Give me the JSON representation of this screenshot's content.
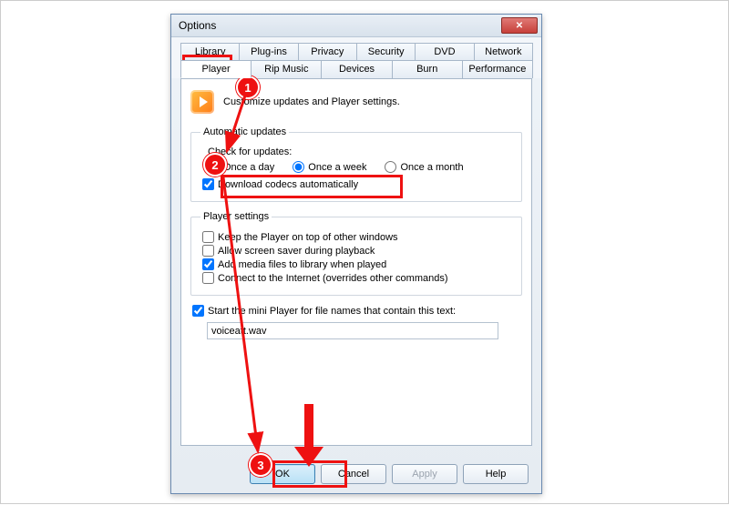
{
  "window": {
    "title": "Options"
  },
  "tabs_row1": [
    "Library",
    "Plug-ins",
    "Privacy",
    "Security",
    "DVD",
    "Network"
  ],
  "tabs_row2": [
    "Player",
    "Rip Music",
    "Devices",
    "Burn",
    "Performance"
  ],
  "active_tab": "Player",
  "intro": "Customize updates and Player settings.",
  "auto_updates": {
    "legend": "Automatic updates",
    "check_label": "Check for updates:",
    "options": [
      "Once a day",
      "Once a week",
      "Once a month"
    ],
    "selected": "Once a week",
    "download_codecs": {
      "label": "Download codecs automatically",
      "checked": true
    }
  },
  "player_settings": {
    "legend": "Player settings",
    "items": [
      {
        "label": "Keep the Player on top of other windows",
        "checked": false
      },
      {
        "label": "Allow screen saver during playback",
        "checked": false
      },
      {
        "label": "Add media files to library when played",
        "checked": true
      },
      {
        "label": "Connect to the Internet (overrides other commands)",
        "checked": false
      }
    ]
  },
  "start_mini": {
    "label": "Start the mini Player for file names that contain this text:",
    "checked": true,
    "value": "voiceatt.wav"
  },
  "buttons": {
    "ok": "OK",
    "cancel": "Cancel",
    "apply": "Apply",
    "help": "Help"
  },
  "annotations": {
    "step1": "1",
    "step2": "2",
    "step3": "3"
  }
}
